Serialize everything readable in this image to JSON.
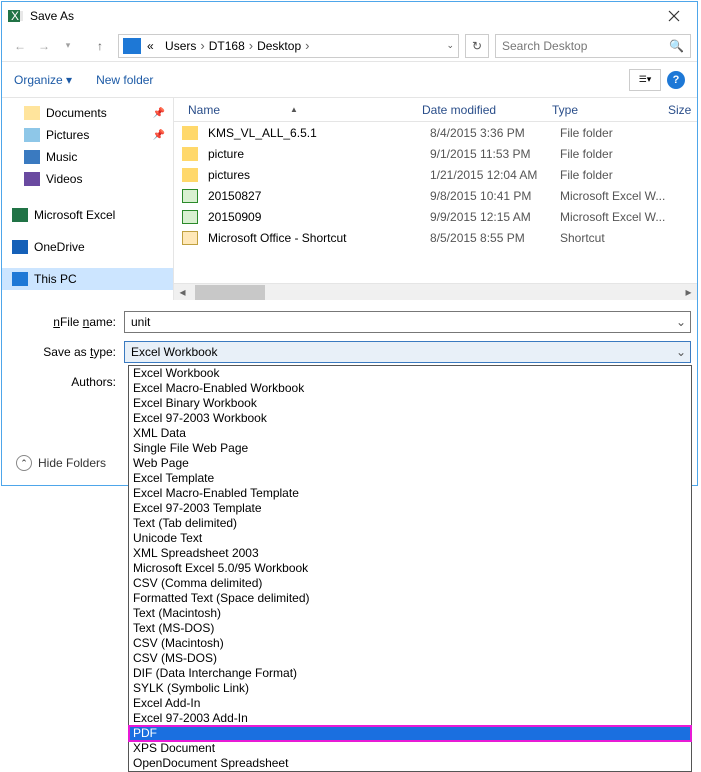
{
  "title": "Save As",
  "breadcrumb": {
    "prefix": "«",
    "parts": [
      "Users",
      "DT168",
      "Desktop"
    ]
  },
  "search_placeholder": "Search Desktop",
  "toolbar": {
    "organize": "Organize",
    "newfolder": "New folder"
  },
  "tree": [
    {
      "label": "Documents",
      "icon": "doc",
      "pin": true
    },
    {
      "label": "Pictures",
      "icon": "pic",
      "pin": true
    },
    {
      "label": "Music",
      "icon": "music"
    },
    {
      "label": "Videos",
      "icon": "video"
    },
    {
      "label": "Microsoft Excel",
      "icon": "excel"
    },
    {
      "label": "OneDrive",
      "icon": "onedrive"
    },
    {
      "label": "This PC",
      "icon": "pc",
      "selected": true
    }
  ],
  "columns": {
    "name": "Name",
    "date": "Date modified",
    "type": "Type",
    "size": "Size"
  },
  "files": [
    {
      "name": "KMS_VL_ALL_6.5.1",
      "date": "8/4/2015 3:36 PM",
      "type": "File folder",
      "icon": "folder"
    },
    {
      "name": "picture",
      "date": "9/1/2015 11:53 PM",
      "type": "File folder",
      "icon": "folder"
    },
    {
      "name": "pictures",
      "date": "1/21/2015 12:04 AM",
      "type": "File folder",
      "icon": "folder"
    },
    {
      "name": "20150827",
      "date": "9/8/2015 10:41 PM",
      "type": "Microsoft Excel W...",
      "icon": "xl"
    },
    {
      "name": "20150909",
      "date": "9/9/2015 12:15 AM",
      "type": "Microsoft Excel W...",
      "icon": "xl"
    },
    {
      "name": "Microsoft Office - Shortcut",
      "date": "8/5/2015 8:55 PM",
      "type": "Shortcut",
      "icon": "sc"
    }
  ],
  "form": {
    "filename_label": "File name:",
    "filename_value": "unit",
    "saveas_label": "Save as type:",
    "saveas_value": "Excel Workbook",
    "authors_label": "Authors:"
  },
  "hide_folders": "Hide Folders",
  "filetypes": [
    "Excel Workbook",
    "Excel Macro-Enabled Workbook",
    "Excel Binary Workbook",
    "Excel 97-2003 Workbook",
    "XML Data",
    "Single File Web Page",
    "Web Page",
    "Excel Template",
    "Excel Macro-Enabled Template",
    "Excel 97-2003 Template",
    "Text (Tab delimited)",
    "Unicode Text",
    "XML Spreadsheet 2003",
    "Microsoft Excel 5.0/95 Workbook",
    "CSV (Comma delimited)",
    "Formatted Text (Space delimited)",
    "Text (Macintosh)",
    "Text (MS-DOS)",
    "CSV (Macintosh)",
    "CSV (MS-DOS)",
    "DIF (Data Interchange Format)",
    "SYLK (Symbolic Link)",
    "Excel Add-In",
    "Excel 97-2003 Add-In",
    "PDF",
    "XPS Document",
    "OpenDocument Spreadsheet"
  ],
  "highlight_index": 24
}
